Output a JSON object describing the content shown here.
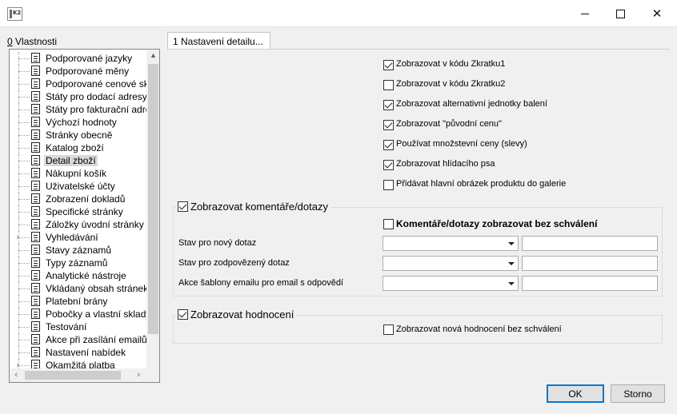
{
  "window": {
    "app_icon_text": "K2",
    "min_glyph": "",
    "max_glyph": "",
    "close_glyph": "✕"
  },
  "sidebar": {
    "title_hotkey": "0",
    "title_rest": " Vlastnosti",
    "items": [
      {
        "label": "Podporované jazyky",
        "icon": "document-icon",
        "expander": ""
      },
      {
        "label": "Podporované měny",
        "icon": "document-icon",
        "expander": ""
      },
      {
        "label": "Podporované cenové skup",
        "icon": "document-icon",
        "expander": ""
      },
      {
        "label": "Státy pro dodací adresy",
        "icon": "document-icon",
        "expander": ""
      },
      {
        "label": "Státy pro fakturační adres",
        "icon": "document-icon",
        "expander": ""
      },
      {
        "label": "Výchozí hodnoty",
        "icon": "document-icon",
        "expander": ""
      },
      {
        "label": "Stránky obecně",
        "icon": "document-icon",
        "expander": ""
      },
      {
        "label": "Katalog zboží",
        "icon": "document-icon",
        "expander": ""
      },
      {
        "label": "Detail zboží",
        "icon": "document-icon",
        "expander": "",
        "selected": true
      },
      {
        "label": "Nákupní košík",
        "icon": "document-icon",
        "expander": ""
      },
      {
        "label": "Uživatelské účty",
        "icon": "document-icon",
        "expander": ""
      },
      {
        "label": "Zobrazení dokladů",
        "icon": "document-icon",
        "expander": ""
      },
      {
        "label": "Specifické stránky",
        "icon": "document-icon",
        "expander": ""
      },
      {
        "label": "Záložky úvodní stránky",
        "icon": "document-icon",
        "expander": ""
      },
      {
        "label": "Vyhledávání",
        "icon": "document-icon",
        "expander": "›"
      },
      {
        "label": "Stavy záznamů",
        "icon": "document-icon",
        "expander": ""
      },
      {
        "label": "Typy záznamů",
        "icon": "document-icon",
        "expander": ""
      },
      {
        "label": "Analytické nástroje",
        "icon": "document-icon",
        "expander": ""
      },
      {
        "label": "Vkládaný obsah stránek",
        "icon": "document-icon",
        "expander": ""
      },
      {
        "label": "Platební brány",
        "icon": "document-icon",
        "expander": ""
      },
      {
        "label": "Pobočky a vlastní sklady",
        "icon": "document-icon",
        "expander": ""
      },
      {
        "label": "Testování",
        "icon": "document-icon",
        "expander": ""
      },
      {
        "label": "Akce při zasílání emailů",
        "icon": "document-icon",
        "expander": ""
      },
      {
        "label": "Nastavení nabídek",
        "icon": "document-icon",
        "expander": ""
      },
      {
        "label": "Okamžitá platba",
        "icon": "document-icon",
        "expander": "›"
      }
    ],
    "scroll_left": "‹",
    "scroll_right": "›",
    "scroll_up": "▲"
  },
  "tab": {
    "label": "1 Nastavení detailu..."
  },
  "options": [
    {
      "label": "Zobrazovat v kódu Zkratku1",
      "checked": true
    },
    {
      "label": "Zobrazovat v kódu Zkratku2",
      "checked": false
    },
    {
      "label": "Zobrazovat alternativní jednotky balení",
      "checked": true
    },
    {
      "label": "Zobrazovat \"původní cenu\"",
      "checked": true
    },
    {
      "label": "Používat množstevní ceny (slevy)",
      "checked": true
    },
    {
      "label": "Zobrazovat hlídacího psa",
      "checked": true
    },
    {
      "label": "Přidávat hlavní obrázek produktu do galerie",
      "checked": false
    }
  ],
  "comments_group": {
    "label": "Zobrazovat komentáře/dotazy",
    "checked": true,
    "no_approval_label": "Komentáře/dotazy zobrazovat bez schválení",
    "no_approval_checked": false,
    "fields": [
      {
        "label": "Stav pro nový dotaz",
        "select_value": "",
        "text_value": ""
      },
      {
        "label": "Stav pro zodpovězený dotaz",
        "select_value": "",
        "text_value": ""
      },
      {
        "label": "Akce šablony emailu pro email s odpovědí",
        "select_value": "",
        "text_value": ""
      }
    ]
  },
  "ratings_group": {
    "label": "Zobrazovat hodnocení",
    "checked": true,
    "no_approval_label": "Zobrazovat nová hodnocení bez schválení",
    "no_approval_checked": false
  },
  "buttons": {
    "ok": "OK",
    "cancel": "Storno"
  },
  "colors": {
    "accent": "#0078d7",
    "selection": "#d9d9d9",
    "background": "#f0f0f0"
  }
}
